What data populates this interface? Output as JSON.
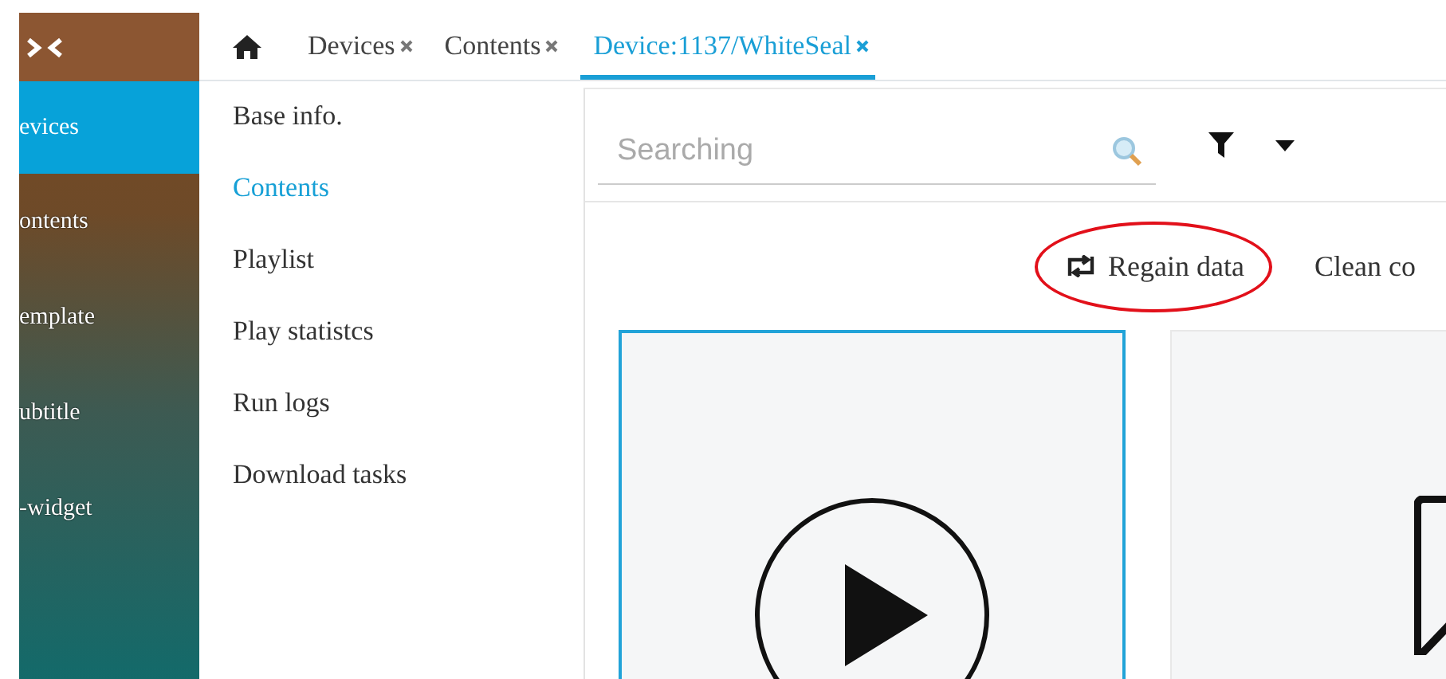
{
  "sidebar": {
    "items": [
      {
        "label": "evices",
        "selected": true
      },
      {
        "label": "ontents",
        "selected": false
      },
      {
        "label": "emplate",
        "selected": false
      },
      {
        "label": "ubtitle",
        "selected": false
      },
      {
        "label": "-widget",
        "selected": false
      }
    ]
  },
  "tabs": [
    {
      "label": "Devices",
      "selected": false
    },
    {
      "label": "Contents",
      "selected": false
    },
    {
      "label": "Device:1137/WhiteSeal",
      "selected": true
    }
  ],
  "subnav": [
    {
      "label": "Base info.",
      "selected": false
    },
    {
      "label": "Contents",
      "selected": true
    },
    {
      "label": "Playlist",
      "selected": false
    },
    {
      "label": "Play statistcs",
      "selected": false
    },
    {
      "label": "Run logs",
      "selected": false
    },
    {
      "label": "Download tasks",
      "selected": false
    }
  ],
  "search": {
    "placeholder": "Searching"
  },
  "actions": [
    {
      "label": "Regain data",
      "kind": "repeat",
      "circled": true
    },
    {
      "label": "Clean co",
      "kind": "plain",
      "circled": false
    }
  ],
  "cards": [
    {
      "kind": "video",
      "selected": true
    },
    {
      "kind": "image",
      "selected": false
    }
  ]
}
